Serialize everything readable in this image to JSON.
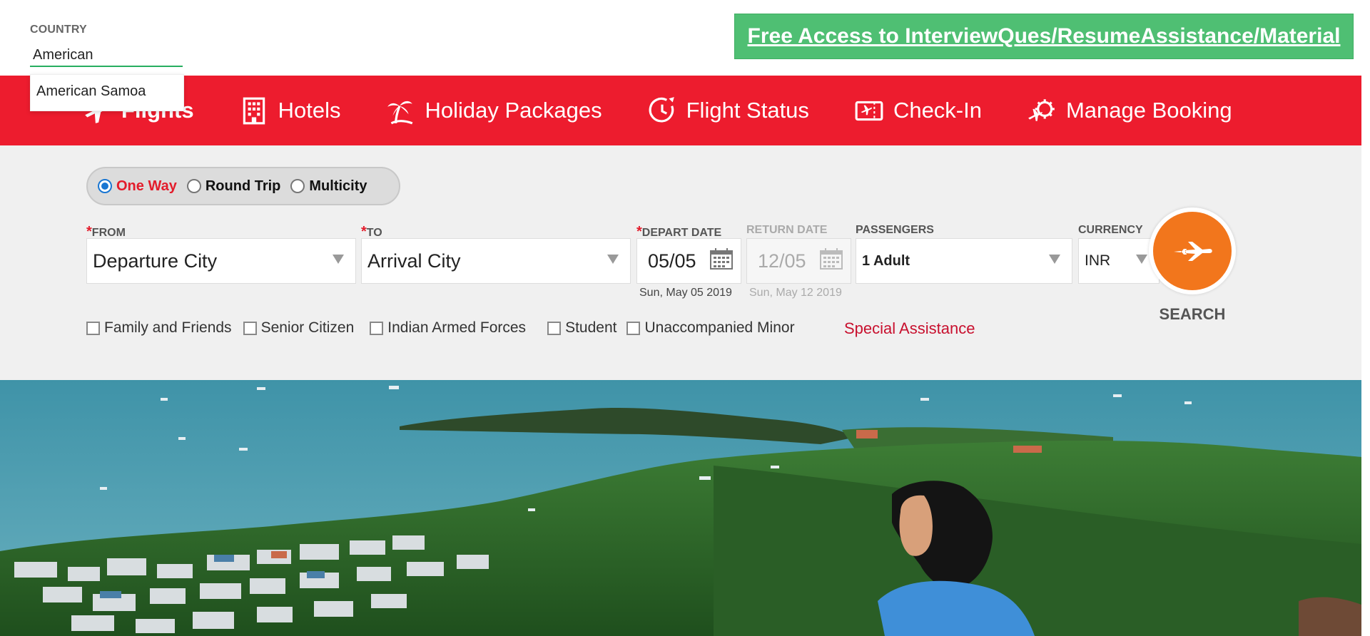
{
  "country": {
    "label": "COUNTRY",
    "value": "American",
    "suggestions": [
      "American Samoa"
    ]
  },
  "promo": {
    "text": "Free Access to InterviewQues/ResumeAssistance/Material"
  },
  "nav": {
    "items": [
      {
        "label": "Flights",
        "icon": "plane-icon",
        "active": true
      },
      {
        "label": "Hotels",
        "icon": "hotel-icon"
      },
      {
        "label": "Holiday Packages",
        "icon": "palm-tree-icon"
      },
      {
        "label": "Flight Status",
        "icon": "clock-plane-icon"
      },
      {
        "label": "Check-In",
        "icon": "ticket-icon"
      },
      {
        "label": "Manage Booking",
        "icon": "gear-plane-icon"
      }
    ]
  },
  "trip": {
    "options": [
      "One Way",
      "Round Trip",
      "Multicity"
    ],
    "selected": "One Way"
  },
  "form": {
    "from": {
      "label": "FROM",
      "value": "Departure City"
    },
    "to": {
      "label": "TO",
      "value": "Arrival City"
    },
    "depart": {
      "label": "DEPART DATE",
      "value": "05/05",
      "sub": "Sun, May 05 2019"
    },
    "return": {
      "label": "RETURN DATE",
      "value": "12/05",
      "sub": "Sun, May 12 2019"
    },
    "passengers": {
      "label": "PASSENGERS",
      "value": "1 Adult"
    },
    "currency": {
      "label": "CURRENCY",
      "value": "INR"
    },
    "search_label": "SEARCH"
  },
  "options": [
    "Family and Friends",
    "Senior Citizen",
    "Indian Armed Forces",
    "Student",
    "Unaccompanied Minor"
  ],
  "special_assistance": "Special Assistance",
  "colors": {
    "nav_red": "#ed1c2e",
    "promo_green": "#4fbf73",
    "search_orange": "#f2761c",
    "selected_red": "#e31c2b"
  }
}
